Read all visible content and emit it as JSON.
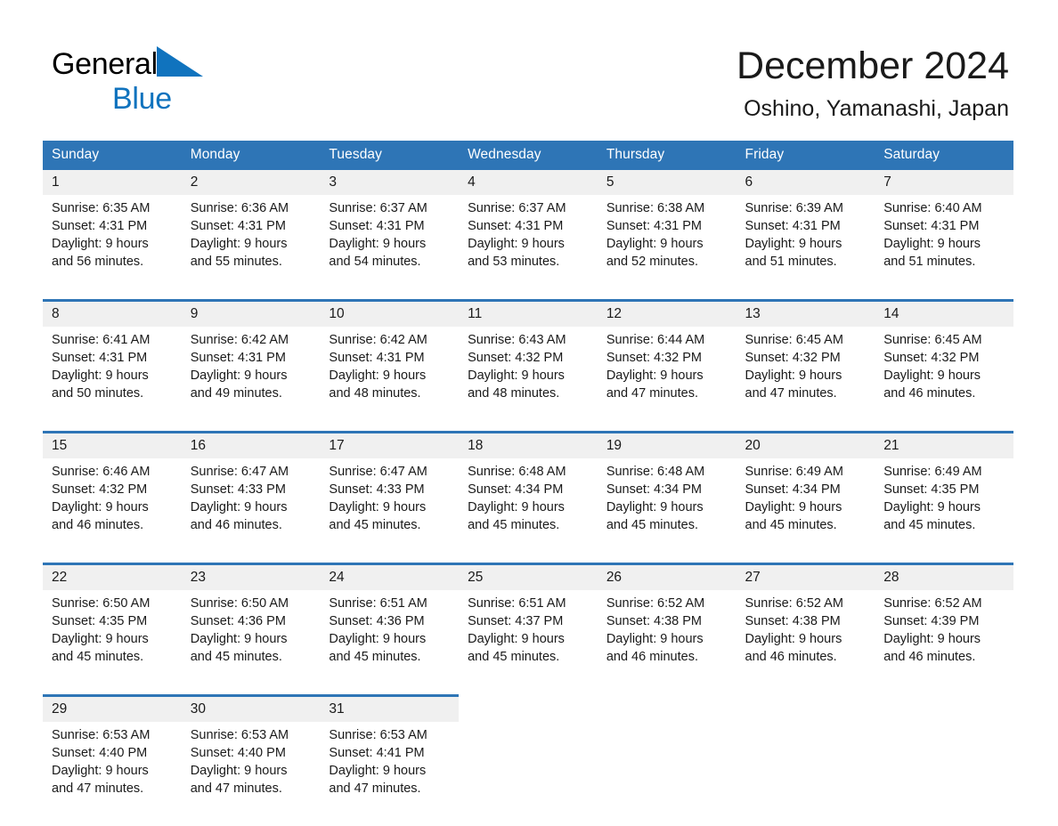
{
  "brand": {
    "name_part1": "General",
    "name_part2": "Blue",
    "logo_icon": "triangle-logo-icon",
    "accent_color": "#1073BE"
  },
  "header": {
    "month_title": "December 2024",
    "location": "Oshino, Yamanashi, Japan"
  },
  "theme": {
    "header_blue": "#2E75B6",
    "date_strip_gray": "#F0F0F0",
    "text_color": "#1a1a1a"
  },
  "calendar": {
    "weekday_headers": [
      "Sunday",
      "Monday",
      "Tuesday",
      "Wednesday",
      "Thursday",
      "Friday",
      "Saturday"
    ],
    "weeks": [
      {
        "days": [
          {
            "date": "1",
            "sunrise": "Sunrise: 6:35 AM",
            "sunset": "Sunset: 4:31 PM",
            "daylight_line1": "Daylight: 9 hours",
            "daylight_line2": "and 56 minutes."
          },
          {
            "date": "2",
            "sunrise": "Sunrise: 6:36 AM",
            "sunset": "Sunset: 4:31 PM",
            "daylight_line1": "Daylight: 9 hours",
            "daylight_line2": "and 55 minutes."
          },
          {
            "date": "3",
            "sunrise": "Sunrise: 6:37 AM",
            "sunset": "Sunset: 4:31 PM",
            "daylight_line1": "Daylight: 9 hours",
            "daylight_line2": "and 54 minutes."
          },
          {
            "date": "4",
            "sunrise": "Sunrise: 6:37 AM",
            "sunset": "Sunset: 4:31 PM",
            "daylight_line1": "Daylight: 9 hours",
            "daylight_line2": "and 53 minutes."
          },
          {
            "date": "5",
            "sunrise": "Sunrise: 6:38 AM",
            "sunset": "Sunset: 4:31 PM",
            "daylight_line1": "Daylight: 9 hours",
            "daylight_line2": "and 52 minutes."
          },
          {
            "date": "6",
            "sunrise": "Sunrise: 6:39 AM",
            "sunset": "Sunset: 4:31 PM",
            "daylight_line1": "Daylight: 9 hours",
            "daylight_line2": "and 51 minutes."
          },
          {
            "date": "7",
            "sunrise": "Sunrise: 6:40 AM",
            "sunset": "Sunset: 4:31 PM",
            "daylight_line1": "Daylight: 9 hours",
            "daylight_line2": "and 51 minutes."
          }
        ]
      },
      {
        "days": [
          {
            "date": "8",
            "sunrise": "Sunrise: 6:41 AM",
            "sunset": "Sunset: 4:31 PM",
            "daylight_line1": "Daylight: 9 hours",
            "daylight_line2": "and 50 minutes."
          },
          {
            "date": "9",
            "sunrise": "Sunrise: 6:42 AM",
            "sunset": "Sunset: 4:31 PM",
            "daylight_line1": "Daylight: 9 hours",
            "daylight_line2": "and 49 minutes."
          },
          {
            "date": "10",
            "sunrise": "Sunrise: 6:42 AM",
            "sunset": "Sunset: 4:31 PM",
            "daylight_line1": "Daylight: 9 hours",
            "daylight_line2": "and 48 minutes."
          },
          {
            "date": "11",
            "sunrise": "Sunrise: 6:43 AM",
            "sunset": "Sunset: 4:32 PM",
            "daylight_line1": "Daylight: 9 hours",
            "daylight_line2": "and 48 minutes."
          },
          {
            "date": "12",
            "sunrise": "Sunrise: 6:44 AM",
            "sunset": "Sunset: 4:32 PM",
            "daylight_line1": "Daylight: 9 hours",
            "daylight_line2": "and 47 minutes."
          },
          {
            "date": "13",
            "sunrise": "Sunrise: 6:45 AM",
            "sunset": "Sunset: 4:32 PM",
            "daylight_line1": "Daylight: 9 hours",
            "daylight_line2": "and 47 minutes."
          },
          {
            "date": "14",
            "sunrise": "Sunrise: 6:45 AM",
            "sunset": "Sunset: 4:32 PM",
            "daylight_line1": "Daylight: 9 hours",
            "daylight_line2": "and 46 minutes."
          }
        ]
      },
      {
        "days": [
          {
            "date": "15",
            "sunrise": "Sunrise: 6:46 AM",
            "sunset": "Sunset: 4:32 PM",
            "daylight_line1": "Daylight: 9 hours",
            "daylight_line2": "and 46 minutes."
          },
          {
            "date": "16",
            "sunrise": "Sunrise: 6:47 AM",
            "sunset": "Sunset: 4:33 PM",
            "daylight_line1": "Daylight: 9 hours",
            "daylight_line2": "and 46 minutes."
          },
          {
            "date": "17",
            "sunrise": "Sunrise: 6:47 AM",
            "sunset": "Sunset: 4:33 PM",
            "daylight_line1": "Daylight: 9 hours",
            "daylight_line2": "and 45 minutes."
          },
          {
            "date": "18",
            "sunrise": "Sunrise: 6:48 AM",
            "sunset": "Sunset: 4:34 PM",
            "daylight_line1": "Daylight: 9 hours",
            "daylight_line2": "and 45 minutes."
          },
          {
            "date": "19",
            "sunrise": "Sunrise: 6:48 AM",
            "sunset": "Sunset: 4:34 PM",
            "daylight_line1": "Daylight: 9 hours",
            "daylight_line2": "and 45 minutes."
          },
          {
            "date": "20",
            "sunrise": "Sunrise: 6:49 AM",
            "sunset": "Sunset: 4:34 PM",
            "daylight_line1": "Daylight: 9 hours",
            "daylight_line2": "and 45 minutes."
          },
          {
            "date": "21",
            "sunrise": "Sunrise: 6:49 AM",
            "sunset": "Sunset: 4:35 PM",
            "daylight_line1": "Daylight: 9 hours",
            "daylight_line2": "and 45 minutes."
          }
        ]
      },
      {
        "days": [
          {
            "date": "22",
            "sunrise": "Sunrise: 6:50 AM",
            "sunset": "Sunset: 4:35 PM",
            "daylight_line1": "Daylight: 9 hours",
            "daylight_line2": "and 45 minutes."
          },
          {
            "date": "23",
            "sunrise": "Sunrise: 6:50 AM",
            "sunset": "Sunset: 4:36 PM",
            "daylight_line1": "Daylight: 9 hours",
            "daylight_line2": "and 45 minutes."
          },
          {
            "date": "24",
            "sunrise": "Sunrise: 6:51 AM",
            "sunset": "Sunset: 4:36 PM",
            "daylight_line1": "Daylight: 9 hours",
            "daylight_line2": "and 45 minutes."
          },
          {
            "date": "25",
            "sunrise": "Sunrise: 6:51 AM",
            "sunset": "Sunset: 4:37 PM",
            "daylight_line1": "Daylight: 9 hours",
            "daylight_line2": "and 45 minutes."
          },
          {
            "date": "26",
            "sunrise": "Sunrise: 6:52 AM",
            "sunset": "Sunset: 4:38 PM",
            "daylight_line1": "Daylight: 9 hours",
            "daylight_line2": "and 46 minutes."
          },
          {
            "date": "27",
            "sunrise": "Sunrise: 6:52 AM",
            "sunset": "Sunset: 4:38 PM",
            "daylight_line1": "Daylight: 9 hours",
            "daylight_line2": "and 46 minutes."
          },
          {
            "date": "28",
            "sunrise": "Sunrise: 6:52 AM",
            "sunset": "Sunset: 4:39 PM",
            "daylight_line1": "Daylight: 9 hours",
            "daylight_line2": "and 46 minutes."
          }
        ]
      },
      {
        "days": [
          {
            "date": "29",
            "sunrise": "Sunrise: 6:53 AM",
            "sunset": "Sunset: 4:40 PM",
            "daylight_line1": "Daylight: 9 hours",
            "daylight_line2": "and 47 minutes."
          },
          {
            "date": "30",
            "sunrise": "Sunrise: 6:53 AM",
            "sunset": "Sunset: 4:40 PM",
            "daylight_line1": "Daylight: 9 hours",
            "daylight_line2": "and 47 minutes."
          },
          {
            "date": "31",
            "sunrise": "Sunrise: 6:53 AM",
            "sunset": "Sunset: 4:41 PM",
            "daylight_line1": "Daylight: 9 hours",
            "daylight_line2": "and 47 minutes."
          },
          null,
          null,
          null,
          null
        ]
      }
    ]
  }
}
